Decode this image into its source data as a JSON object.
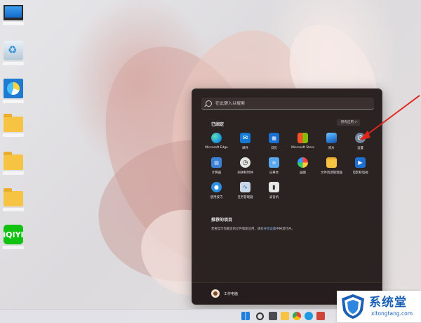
{
  "start_menu": {
    "search_placeholder": "在此键入以搜索",
    "pinned_title": "已固定",
    "all_apps_label": "所有应用 >",
    "pinned_apps": [
      {
        "label": "Microsoft Edge",
        "icon": "edge-icon",
        "color": "#1e9be0"
      },
      {
        "label": "邮件",
        "icon": "mail-icon",
        "color": "#1479d4"
      },
      {
        "label": "日历",
        "icon": "calendar-icon",
        "color": "#1b6fd1"
      },
      {
        "label": "Microsoft Store",
        "icon": "store-icon",
        "color": "#f1f1f1"
      },
      {
        "label": "照片",
        "icon": "photos-icon",
        "color": "#2e7fd8"
      },
      {
        "label": "设置",
        "icon": "gear-icon",
        "color": "#7a8ea3"
      },
      {
        "label": "计算器",
        "icon": "calculator-icon",
        "color": "#3b82d6"
      },
      {
        "label": "闹钟和时钟",
        "icon": "clock-icon",
        "color": "#e4e4e4"
      },
      {
        "label": "记事本",
        "icon": "notepad-icon",
        "color": "#58a7ea"
      },
      {
        "label": "画图",
        "icon": "paint-icon",
        "color": "#f4f4f4"
      },
      {
        "label": "文件资源管理器",
        "icon": "folder-icon",
        "color": "#f6c342"
      },
      {
        "label": "电影和电视",
        "icon": "movies-icon",
        "color": "#1f6fd0"
      },
      {
        "label": "使用技巧",
        "icon": "tips-icon",
        "color": "#2f8ee0"
      },
      {
        "label": "任务管理器",
        "icon": "task-manager-icon",
        "color": "#c8d6e6"
      },
      {
        "label": "录音机",
        "icon": "voice-recorder-icon",
        "color": "#e6e6e6"
      }
    ],
    "recommended_title": "推荐的项目",
    "recommended_text": "若要显示你最近的文件和新应用，请在",
    "recommended_link": "开始设置",
    "recommended_suffix": "中将其打开。",
    "user_name": "工作电脑"
  },
  "watermark": {
    "title": "系统堂",
    "url": "xitongtang.com"
  },
  "colors": {
    "start_bg": "#2b2222",
    "arrow": "#e0251b"
  }
}
